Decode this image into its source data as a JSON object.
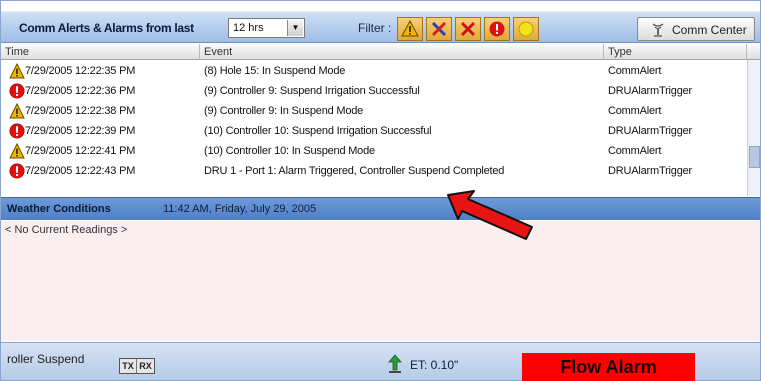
{
  "toolbar": {
    "title": "Comm Alerts & Alarms from last",
    "range_value": "12 hrs",
    "filter_label": "Filter :",
    "filters": [
      {
        "name": "alert-filter",
        "icon": "warning-triangle-icon"
      },
      {
        "name": "comm-error-filter",
        "icon": "blue-x-icon"
      },
      {
        "name": "error-filter",
        "icon": "red-x-icon"
      },
      {
        "name": "alarm-filter",
        "icon": "red-exclamation-icon"
      },
      {
        "name": "info-filter",
        "icon": "yellow-circle-icon"
      }
    ],
    "comm_center_label": "Comm Center"
  },
  "grid": {
    "columns": [
      "Time",
      "Event",
      "Type"
    ],
    "rows": [
      {
        "icon": "warning",
        "time": "7/29/2005 12:22:35 PM",
        "event": "(8)  Hole 15: In Suspend Mode",
        "type": "CommAlert"
      },
      {
        "icon": "alarm",
        "time": "7/29/2005 12:22:36 PM",
        "event": "(9)  Controller 9: Suspend Irrigation Successful",
        "type": "DRUAlarmTrigger"
      },
      {
        "icon": "warning",
        "time": "7/29/2005 12:22:38 PM",
        "event": "(9)  Controller 9: In Suspend Mode",
        "type": "CommAlert"
      },
      {
        "icon": "alarm",
        "time": "7/29/2005 12:22:39 PM",
        "event": "(10)  Controller 10: Suspend Irrigation Successful",
        "type": "DRUAlarmTrigger"
      },
      {
        "icon": "warning",
        "time": "7/29/2005 12:22:41 PM",
        "event": "(10)  Controller 10: In Suspend Mode",
        "type": "CommAlert"
      },
      {
        "icon": "alarm",
        "time": "7/29/2005 12:22:43 PM",
        "event": "DRU 1 - Port 1: Alarm Triggered, Controller Suspend Completed",
        "type": "DRUAlarmTrigger"
      }
    ]
  },
  "weather": {
    "title": "Weather Conditions",
    "timestamp": "11:42 AM, Friday, July 29, 2005",
    "readings": "< No Current Readings >"
  },
  "status": {
    "text": "roller Suspend",
    "tx": "TX",
    "rx": "RX",
    "et": "ET: 0.10\"",
    "flow_alarm": "Flow Alarm"
  },
  "colors": {
    "alarm_red": "#ff0000",
    "weather_bar": "#5a8acf",
    "readings_bg": "#fbeef0"
  }
}
